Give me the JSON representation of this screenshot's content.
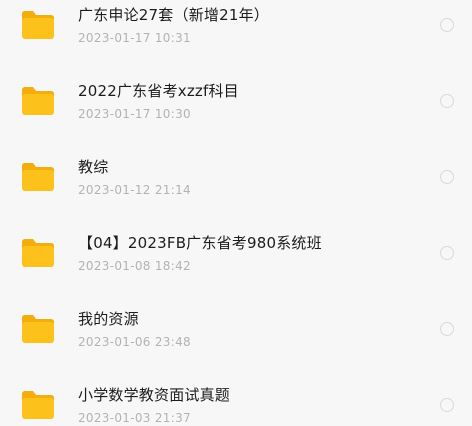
{
  "files": [
    {
      "name": "广东申论27套（新增21年）",
      "date": "2023-01-17 10:31"
    },
    {
      "name": "2022广东省考xzzf科目",
      "date": "2023-01-17 10:30"
    },
    {
      "name": "教综",
      "date": "2023-01-12 21:14"
    },
    {
      "name": "【04】2023FB广东省考980系统班",
      "date": "2023-01-08 18:42"
    },
    {
      "name": "我的资源",
      "date": "2023-01-06 23:48"
    },
    {
      "name": "小学数学教资面试真题",
      "date": "2023-01-03 21:37"
    }
  ],
  "colors": {
    "folder_body": "#fcc21b",
    "folder_tab": "#f4ae0c",
    "background": "#f7f7f7",
    "date_text": "#b3b3b3"
  },
  "icons": {
    "folder": "folder-icon",
    "select": "radio-circle-icon"
  }
}
